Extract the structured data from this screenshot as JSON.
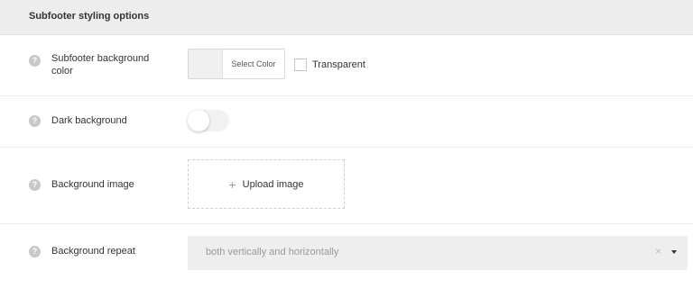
{
  "section": {
    "title": "Subfooter styling options"
  },
  "help_icon_glyph": "?",
  "rows": {
    "bg_color": {
      "label": "Subfooter background color",
      "button_label": "Select Color",
      "transparent_label": "Transparent",
      "transparent_checked": false
    },
    "dark_bg": {
      "label": "Dark background",
      "toggle_on": false
    },
    "bg_image": {
      "label": "Background image",
      "upload_icon": "+",
      "upload_label": "Upload image"
    },
    "bg_repeat": {
      "label": "Background repeat",
      "selected_value": "both vertically and horizontally",
      "clear_icon": "×"
    }
  },
  "colors": {
    "header_bg": "#ededed",
    "help_icon_bg": "#c8c8c8",
    "select_bg": "#eeeeee"
  }
}
